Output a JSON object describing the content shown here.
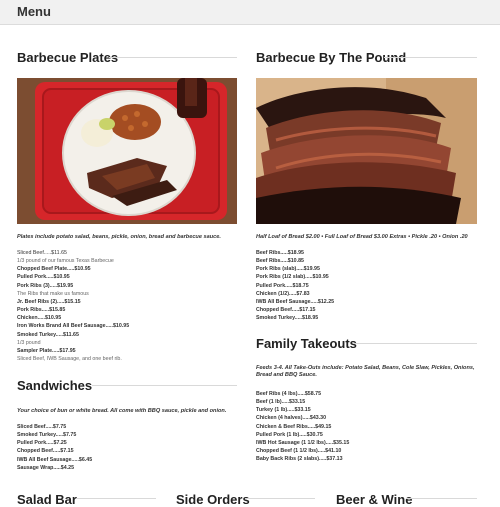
{
  "header": {
    "title": "Menu"
  },
  "sections": {
    "bbq_plates": {
      "title": "Barbecue Plates",
      "note": "Plates include potato salad, beans, pickle, onion, bread and barbecue sauce.",
      "items": [
        {
          "text": "Sliced Beef.....$11.65",
          "bold": false
        },
        {
          "text": "1/3 pound of our famous Texas Barbecue",
          "bold": false,
          "muted": true
        },
        {
          "text": "Chopped Beef Plate.....$10.95",
          "bold": true
        },
        {
          "text": "Pulled Pork.....$10.95",
          "bold": true
        },
        {
          "text": "Pork Ribs (3).....$19.95",
          "bold": true
        },
        {
          "text": "The Ribs that make us famous",
          "bold": false,
          "muted": true
        },
        {
          "text": "Jr. Beef Ribs (2).....$15.15",
          "bold": true
        },
        {
          "text": "Pork Ribs.....$15.85",
          "bold": true
        },
        {
          "text": "Chicken.....$10.95",
          "bold": true
        },
        {
          "text": "Iron Works Brand All Beef Sausage.....$10.95",
          "bold": true
        },
        {
          "text": "Smoked Turkey.....$11.65",
          "bold": true
        },
        {
          "text": "1/3 pound",
          "bold": false,
          "muted": true
        },
        {
          "text": "Sampler Plate.....$17.95",
          "bold": true
        },
        {
          "text": "Sliced Beef, IWB Sausage, and one beef rib.",
          "bold": false,
          "muted": true
        }
      ]
    },
    "by_the_pound": {
      "title": "Barbecue By The Pound",
      "note": "Half Loaf of Bread $2.00 • Full Loaf of Bread $3.00 Extras • Pickle .20 • Onion .20",
      "items": [
        {
          "text": "Beef Ribs.....$18.95"
        },
        {
          "text": "Beef Ribs.....$10.85"
        },
        {
          "text": "Pork Ribs (slab).....$19.95"
        },
        {
          "text": "Pork Ribs (1/2 slab).....$10.95"
        },
        {
          "text": "Pulled Pork.....$18.75"
        },
        {
          "text": "Chicken (1/2).....$7.83"
        },
        {
          "text": "IWB All Beef Sausage.....$12.25"
        },
        {
          "text": "Chopped Beef.....$17.15"
        },
        {
          "text": "Smoked Turkey.....$18.95"
        }
      ]
    },
    "sandwiches": {
      "title": "Sandwiches",
      "note": "Your choice of bun or white bread. All come with BBQ sauce, pickle and onion.",
      "items": [
        {
          "text": "Sliced Beef.....$7.75"
        },
        {
          "text": "Smoked Turkey.....$7.75"
        },
        {
          "text": "Pulled Pork.....$7.25"
        },
        {
          "text": "Chopped Beef.....$7.15"
        },
        {
          "text": "IWB All Beef Sausage.....$6.45"
        },
        {
          "text": "Sausage Wrap.....$4.25"
        }
      ]
    },
    "family_takeouts": {
      "title": "Family Takeouts",
      "note": "Feeds 3-4. All Take-Outs include: Potato Salad, Beans, Cole Slaw, Pickles, Onions, Bread and BBQ Sauce.",
      "items": [
        {
          "text": "Beef Ribs (4 lbs).....$58.75"
        },
        {
          "text": "Beef (1 lb).....$33.15"
        },
        {
          "text": "Turkey (1 lb).....$33.15"
        },
        {
          "text": "Chicken (4 halves).....$43.30"
        },
        {
          "text": "Chicken & Beef Ribs.....$49.15"
        },
        {
          "text": "Pulled Pork (1 lb).....$30.75"
        },
        {
          "text": "IWB Hot Sausage (1 1/2 lbs).....$35.15"
        },
        {
          "text": "Chopped Beef (1 1/2 lbs).....$41.10"
        },
        {
          "text": "Baby Back Ribs (2 slabs).....$37.13"
        }
      ]
    },
    "bottom_titles": [
      "Salad Bar",
      "Side Orders",
      "Beer & Wine"
    ]
  }
}
